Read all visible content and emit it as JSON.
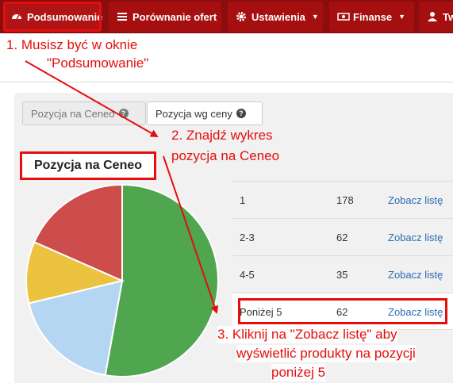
{
  "navbar": {
    "items": [
      {
        "label": "Podsumowanie",
        "icon": "dashboard-icon",
        "active": true
      },
      {
        "label": "Porównanie ofert",
        "icon": "list-icon"
      },
      {
        "label": "Ustawienia",
        "icon": "gear-icon",
        "dropdown": true
      },
      {
        "label": "Finanse",
        "icon": "money-icon",
        "dropdown": true
      },
      {
        "label": "Tw",
        "icon": "user-icon"
      }
    ]
  },
  "tabs": [
    {
      "label": "Pozycja na Ceneo",
      "help_icon": "question-circle-icon",
      "active": false
    },
    {
      "label": "Pozycja wg ceny",
      "help_icon": "question-circle-icon",
      "active": true
    }
  ],
  "chart_title": "Pozycja na Ceneo",
  "chart_data": {
    "type": "pie",
    "categories": [
      "1",
      "2-3",
      "4-5",
      "Poniżej 5"
    ],
    "values": [
      178,
      62,
      35,
      62
    ],
    "colors": [
      "#4fa64f",
      "#b5d6f3",
      "#ecc341",
      "#cd4c4c"
    ]
  },
  "table": {
    "rows": [
      {
        "position": "1",
        "count": "178",
        "link": "Zobacz listę"
      },
      {
        "position": "2-3",
        "count": "62",
        "link": "Zobacz listę"
      },
      {
        "position": "4-5",
        "count": "35",
        "link": "Zobacz listę"
      },
      {
        "position": "Poniżej 5",
        "count": "62",
        "link": "Zobacz listę",
        "highlighted": true
      }
    ]
  },
  "annotations": {
    "step1_line1": "1. Musisz być w oknie",
    "step1_line2": "\"Podsumowanie\"",
    "step2_line1": "2. Znajdź wykres",
    "step2_line2": "pozycja na Ceneo",
    "step3_line1": "3. Kliknij na \"Zobacz listę\" aby",
    "step3_line2": "wyświetlić produkty na pozycji",
    "step3_line3": "poniżej 5",
    "color": "#e40e0e"
  }
}
